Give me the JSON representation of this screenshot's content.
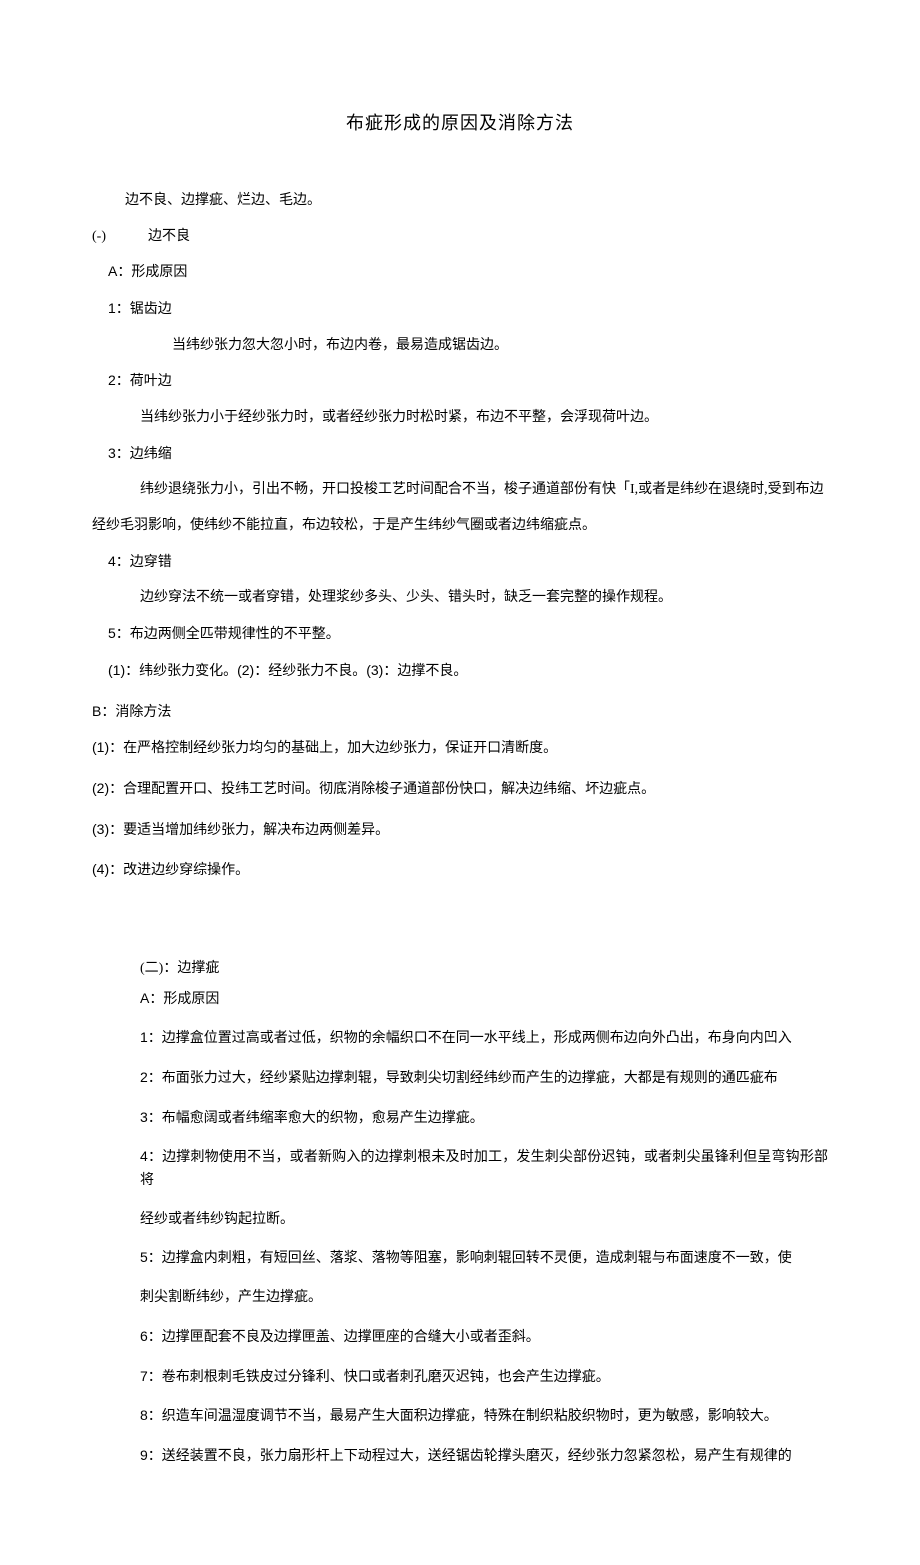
{
  "title": "布疵形成的原因及消除方法",
  "intro": "边不良、边撑疵、烂边、毛边。",
  "s1": {
    "header": "(-) 　　边不良",
    "A_header": "A：形成原因",
    "i1_head": "1：锯齿边",
    "i1_body": "当纬纱张力忽大忽小时，布边内卷，最易造成锯齿边。",
    "i2_head": "2：荷叶边",
    "i2_body": "当纬纱张力小于经纱张力时，或者经纱张力时松时紧，布边不平整，会浮现荷叶边。",
    "i3_head": "3：边纬缩",
    "i3_body_a": "纬纱退绕张力小，引出不畅，开口投梭工艺时间配合不当，梭子通道部份有快「I,或者是纬纱在退绕时,受到布边",
    "i3_body_b": "经纱毛羽影响，使纬纱不能拉直，布边较松，于是产生纬纱气圈或者边纬缩疵点。",
    "i4_head": "4：边穿错",
    "i4_body": "边纱穿法不统一或者穿错，处理浆纱多头、少头、错头时，缺乏一套完整的操作规程。",
    "i5": "5：布边两侧全匹带规律性的不平整。",
    "i5_sub": "(1)：纬纱张力变化。(2)：经纱张力不良。(3)：边撑不良。",
    "B_header": "B：消除方法",
    "b1": "(1)：在严格控制经纱张力均匀的基础上，加大边纱张力，保证开口清断度。",
    "b2": "(2)：合理配置开口、投纬工艺时间。彻底消除梭子通道部份快口，解决边纬缩、坏边疵点。",
    "b3": "(3)：要适当增加纬纱张力，解决布边两侧差异。",
    "b4": "(4)：改进边纱穿综操作。"
  },
  "s2": {
    "header": "(二)：边撑疵",
    "A_header": "A：形成原因",
    "i1": "1：边撑盒位置过高或者过低，织物的余幅织口不在同一水平线上，形成两侧布边向外凸出，布身向内凹入",
    "i2": "2：布面张力过大，经纱紧贴边撑刺辊，导致刺尖切割经纬纱而产生的边撑疵，大都是有规则的通匹疵布",
    "i3": "3：布幅愈阔或者纬缩率愈大的织物，愈易产生边撑疵。",
    "i4_a": "4：边撑刺物使用不当，或者新购入的边撑刺根未及时加工，发生刺尖部份迟钝，或者刺尖虽锋利但呈弯钩形部将",
    "i4_b": "经纱或者纬纱钩起拉断。",
    "i5_a": "5：边撑盒内刺粗，有短回丝、落浆、落物等阻塞，影响刺辊回转不灵便，造成刺辊与布面速度不一致，使",
    "i5_b": "刺尖割断纬纱，产生边撑疵。",
    "i6": "6：边撑匣配套不良及边撑匣盖、边撑匣座的合缝大小或者歪斜。",
    "i7": "7：卷布刺根刺毛铁皮过分锋利、快口或者刺孔磨灭迟钝，也会产生边撑疵。",
    "i8": "8：织造车间温湿度调节不当，最易产生大面积边撑疵，特殊在制织粘胶织物时，更为敏感，影响较大。",
    "i9": "9：送经装置不良，张力扇形杆上下动程过大，送经锯齿轮撑头磨灭，经纱张力忽紧忽松，易产生有规律的"
  }
}
